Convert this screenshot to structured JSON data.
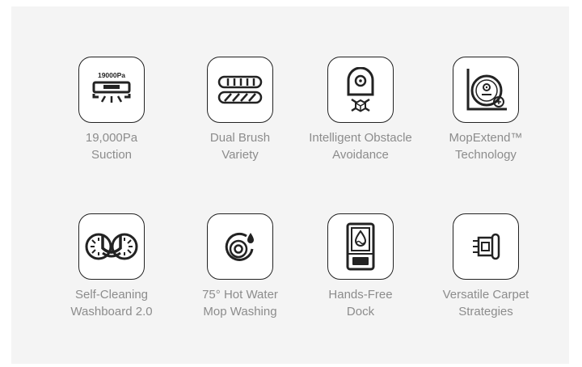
{
  "features": [
    {
      "line1": "19,000Pa",
      "line2": "Suction",
      "icon": "suction-icon",
      "icon_text": "19000Pa"
    },
    {
      "line1": "Dual Brush",
      "line2": "Variety",
      "icon": "dual-brush-icon"
    },
    {
      "line1": "Intelligent Obstacle",
      "line2": "Avoidance",
      "icon": "obstacle-avoidance-icon"
    },
    {
      "line1": "MopExtend™",
      "line2": "Technology",
      "icon": "mop-extend-icon"
    },
    {
      "line1": "Self-Cleaning",
      "line2": "Washboard 2.0",
      "icon": "washboard-icon"
    },
    {
      "line1": "75° Hot Water",
      "line2": "Mop Washing",
      "icon": "hot-water-icon"
    },
    {
      "line1": "Hands-Free",
      "line2": "Dock",
      "icon": "dock-icon"
    },
    {
      "line1": "Versatile Carpet",
      "line2": "Strategies",
      "icon": "carpet-icon"
    }
  ],
  "colors": {
    "background": "#f4f4f4",
    "icon_stroke": "#222222",
    "label": "#8c8c8c"
  }
}
